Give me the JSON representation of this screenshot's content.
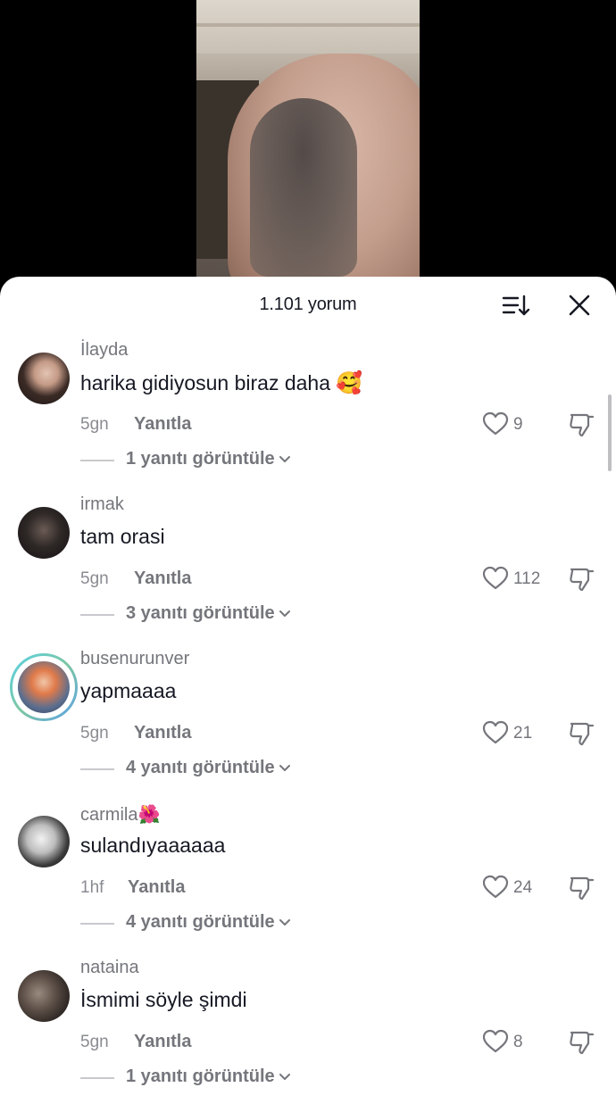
{
  "header": {
    "comment_count": "1.101 yorum"
  },
  "icons": {
    "sort": "sort-icon",
    "close": "close-icon",
    "like": "heart-outline-icon",
    "dislike": "thumbs-down-icon",
    "chevron": "chevron-down-icon"
  },
  "comments": [
    {
      "username": "İlayda",
      "text": "harika gidiyosun biraz daha",
      "emoji": "🥰",
      "time": "5gn",
      "reply_label": "Yanıtla",
      "likes": "9",
      "view_replies": "1 yanıtı görüntüle"
    },
    {
      "username": "irmak",
      "text": "tam orasi",
      "time": "5gn",
      "reply_label": "Yanıtla",
      "likes": "112",
      "view_replies": "3 yanıtı görüntüle"
    },
    {
      "username": "busenurunver",
      "text": "yapmaaaa",
      "time": "5gn",
      "reply_label": "Yanıtla",
      "likes": "21",
      "view_replies": "4 yanıtı görüntüle"
    },
    {
      "username": "carmila",
      "username_emoji": "🌺",
      "text": "sulandıyaaaaaa",
      "time": "1hf",
      "reply_label": "Yanıtla",
      "likes": "24",
      "view_replies": "4 yanıtı görüntüle"
    },
    {
      "username": "nataina",
      "text": "İsmimi söyle şimdi",
      "time": "5gn",
      "reply_label": "Yanıtla",
      "likes": "8",
      "view_replies": "1 yanıtı görüntüle"
    }
  ]
}
